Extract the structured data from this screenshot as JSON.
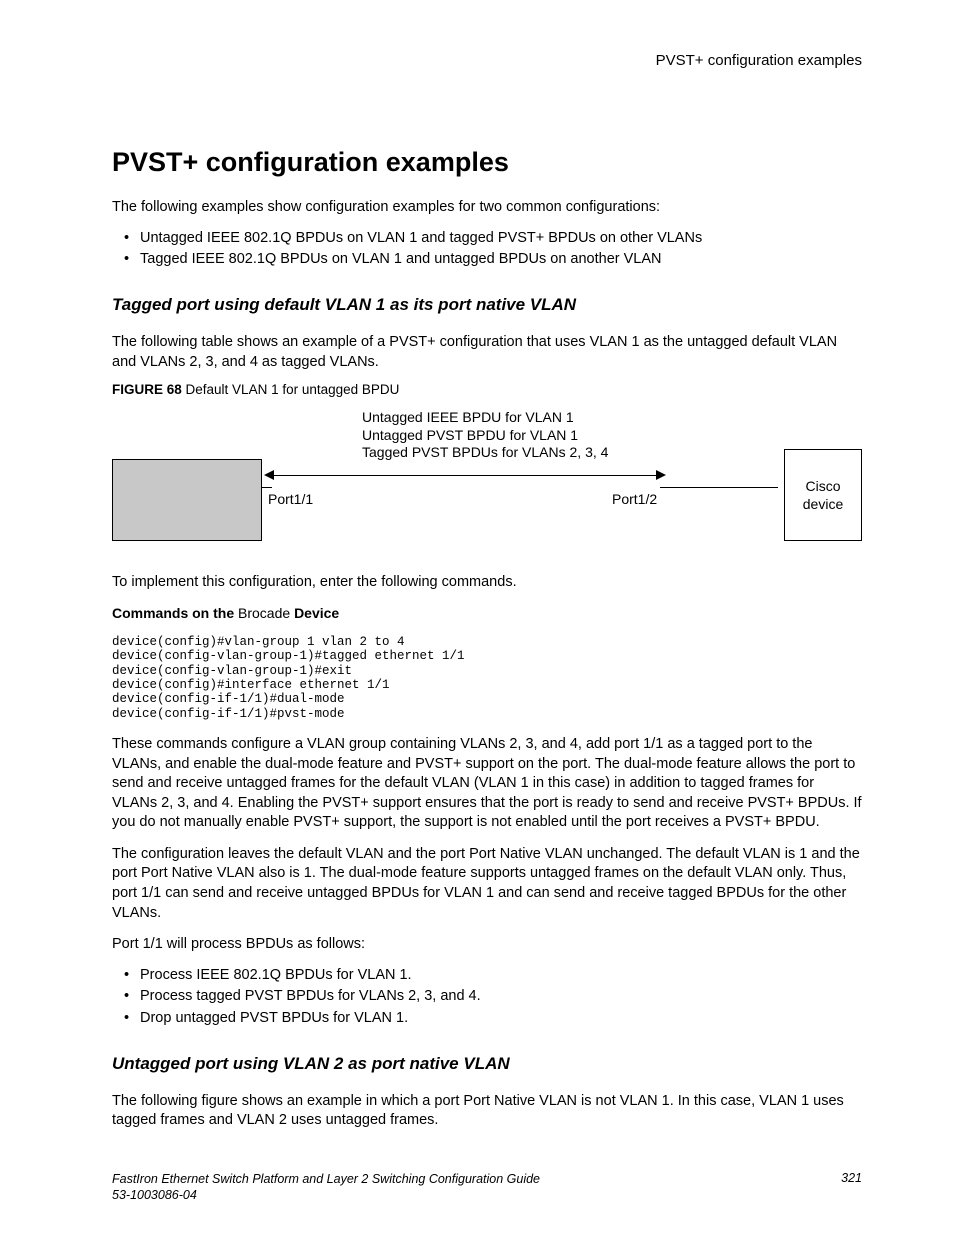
{
  "header": {
    "right": "PVST+ configuration examples"
  },
  "title": "PVST+ configuration examples",
  "intro": "The following examples show configuration examples for two common configurations:",
  "intro_bullets": [
    "Untagged IEEE 802.1Q BPDUs on VLAN 1 and tagged PVST+ BPDUs on other VLANs",
    "Tagged IEEE 802.1Q BPDUs on VLAN 1 and untagged BPDUs on another VLAN"
  ],
  "section1": {
    "heading": "Tagged port using default VLAN 1 as its port native VLAN",
    "p1": "The following table shows an example of a PVST+ configuration that uses VLAN 1 as the untagged default VLAN and VLANs 2, 3, and 4 as tagged VLANs.",
    "fig_label_bold": "FIGURE 68 ",
    "fig_label_rest": "Default VLAN 1 for untagged BPDU",
    "fig": {
      "line1": "Untagged IEEE BPDU for VLAN 1",
      "line2": "Untagged PVST BPDU for VLAN 1",
      "line3": "Tagged PVST BPDUs for VLANs 2, 3, 4",
      "port_left": "Port1/1",
      "port_right": "Port1/2",
      "box_right_l1": "Cisco",
      "box_right_l2": "device"
    },
    "p2": "To implement this configuration, enter the following commands.",
    "cmd_label_b1": "Commands on the ",
    "cmd_label_n": "Brocade ",
    "cmd_label_b2": "Device",
    "code": "device(config)#vlan-group 1 vlan 2 to 4\ndevice(config-vlan-group-1)#tagged ethernet 1/1\ndevice(config-vlan-group-1)#exit\ndevice(config)#interface ethernet 1/1\ndevice(config-if-1/1)#dual-mode\ndevice(config-if-1/1)#pvst-mode",
    "p3": "These commands configure a VLAN group containing VLANs 2, 3, and 4, add port 1/1 as a tagged port to the VLANs, and enable the dual-mode feature and PVST+ support on the port. The dual-mode feature allows the port to send and receive untagged frames for the default VLAN (VLAN 1 in this case) in addition to tagged frames for VLANs 2, 3, and 4. Enabling the PVST+ support ensures that the port is ready to send and receive PVST+ BPDUs. If you do not manually enable PVST+ support, the support is not enabled until the port receives a PVST+ BPDU.",
    "p4": "The configuration leaves the default VLAN and the port Port Native VLAN unchanged. The default VLAN is 1 and the port Port Native VLAN also is 1. The dual-mode feature supports untagged frames on the default VLAN only. Thus, port 1/1 can send and receive untagged BPDUs for VLAN 1 and can send and receive tagged BPDUs for the other VLANs.",
    "p5": "Port 1/1 will process BPDUs as follows:",
    "bullets2": [
      "Process IEEE 802.1Q BPDUs for VLAN 1.",
      "Process tagged PVST BPDUs for VLANs 2, 3, and 4.",
      "Drop untagged PVST BPDUs for VLAN 1."
    ]
  },
  "section2": {
    "heading": "Untagged port using VLAN 2 as port native VLAN",
    "p1": "The following figure shows an example in which a port Port Native VLAN is not VLAN 1. In this case, VLAN 1 uses tagged frames and VLAN 2 uses untagged frames."
  },
  "footer": {
    "left_l1": "FastIron Ethernet Switch Platform and Layer 2 Switching Configuration Guide",
    "left_l2": "53-1003086-04",
    "right": "321"
  }
}
